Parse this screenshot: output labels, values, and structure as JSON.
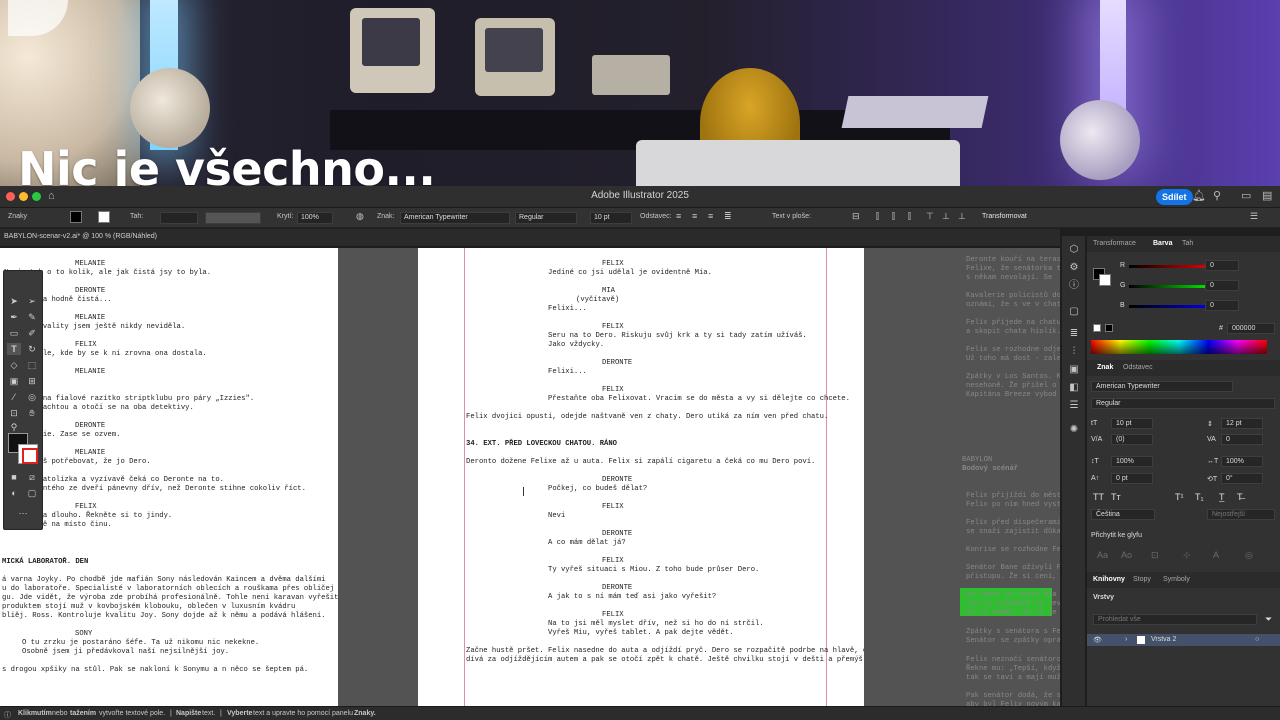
{
  "overlay": {
    "caption": "Nic je všechno..."
  },
  "titlebar": {
    "title": "Adobe Illustrator 2025",
    "share_label": "Sdílet"
  },
  "control_bar": {
    "panel_label": "Znaky",
    "stroke_label": "Tah:",
    "opacity_label": "Krytí:",
    "opacity_value": "100%",
    "character_label": "Znak:",
    "font_family": "American Typewriter",
    "font_style": "Regular",
    "font_size": "10 pt",
    "paragraph_label": "Odstavec:",
    "text_on_path_label": "Text v ploše:",
    "transform_label": "Transformovat"
  },
  "document_tab": {
    "label": "BABYLON-scenar-v2.ai* @ 100 % (RGB/Náhled)"
  },
  "script_left": {
    "lines": [
      "MELANIE",
      "Nevím tak o to kolik, ale jak čistá jsy to byla.",
      "DERONTE",
      "Je že byla hodně čistá...",
      "MELANIE",
      "kovýhle kvality jsem ještě nikdy neviděla.",
      "FELIX",
      "ně zajímale, kde by se k ní zrovna ona dostala.",
      "MELANIE",
      "že tady!",
      "ve ženy, na fialové razítko striptklubu pro páry „Izzies\".",
      "stvolu plachtou a otočí se na oba detektivy.",
      "DERONTE",
      "hoc Melanie. Zase se ozvem.",
      "MELANIE",
      "něco budeš potřebovat, že jo Dero.",
      "procesu patolízka a vyzívavě čeká co Deronte na to.",
      "ujce Derontého ze dveří pánevny dřív, než Deronte stihne cokoliv říct.",
      "FELIX",
      "ny bylo na dlouho. Řekněte si to jindy.",
      "sime ještě na místo činu.",
      "MICKÁ LABORATOŘ. DEN",
      "á varna Joyky. Po chodbě jde mafián Sony následován Kaincem a dvěma dalšími",
      "u do laboratoře. Specialisté v laboratorních oblecích a rouškama přes obličej",
      "gu. Jde vidět, že výroba zde probíhá profesionálně. Tohle není karavan vyřešit,",
      "produktem stojí muž v kovbojském klobouku, oblečen v luxusním kvádru",
      "bliěj. Ross. Kontroluje kvalitu Joy. Sony dojde až k němu a podává hlášení.",
      "SONY",
      "O tu zrzku je postaráno šéfe. Ta už nikomu nic nekekne.",
      "Osobně jsem ji předávkoval naší nejsilnější joy.",
      "s drogou xpšiky na stůl. Pak se nakloní k Sonymu a n něco se šeptem pá."
    ]
  },
  "script_mid": {
    "lines": [
      "FELIX",
      "Jediné co jsi udělal je ovidentně Mia.",
      "MIA",
      "(vyčítavě)",
      "Felixi...",
      "FELIX",
      "Seru na to Dero. Riskuju svůj krk a ty si tady zatím užíváš.",
      "Jako vždycky.",
      "DERONTE",
      "Felixi...",
      "FELIX",
      "Přestaňte oba Felixovat. Vracím se do města a vy si dělejte co chcete.",
      "Felix dvojici opustí, odejde naštvaně ven z chaty. Dero utíká za ním ven před chatu.",
      "34.      EXT. PŘED LOVECKOU CHATOU. RÁNO",
      "Deronto dožene Felixe až u auta. Felix si zapálí cigaretu a čeká co mu Dero poví.",
      "DERONTE",
      "Počkej, co budeš dělat?",
      "FELIX",
      "Nevi",
      "DERONTE",
      "A co mám dělat já?",
      "FELIX",
      "Ty vyřeš situaci s Miou. Z toho bude průser Dero.",
      "DERONTE",
      "A jak to s ní mám teď asi jako vyřešit?",
      "FELIX",
      "Na to jsi měl myslet dřív, než si ho do ní strčil.",
      "Vyřeš Miu, vyřeš tablet. A pak dejte vědět.",
      "Začne hustě pršet. Felix nasedne do auta a odjíždí pryč. Dero se rozpačitě podrbe na hlavě, chvíly se",
      "dívá za odjíždějícím autem a pak se otočí zpět k chatě. Ještě chvilku stojí v dešti a přemýšlí."
    ]
  },
  "script_right": {
    "lines": [
      "Deronte kouří na terase",
      "Felixe, že senátorka tam",
      "s někam nevolají. Se",
      "Kavaleríe policistů dore",
      "oznámí, že s ve v chatě",
      "Felix přijede na chatu p",
      "a skopit chata hiolík. Fel",
      "Felix se rozhodne odjet,",
      "Už toho má dost - zaleze",
      "Zpátky v Los Santos. K",
      "nesehoně. Že přišel o",
      "Kapitána Breeze vybod",
      "BABYLON",
      "Bodový scénář",
      "Felix přijíždí do města po",
      "Felix po nim hned vystat",
      "Felix před dispečerami",
      "se snaží zajistit důkazy, s",
      "Konrise se rozhodne Feli",
      "Senátor Bane oživyli Feli",
      "přistupu. Že si ceni, že c",
      "Na chatě se snaží Mia naj",
      "tím si vzpomene že nevyz",
      "že to vědět, že to je on. D",
      "Zpátky s senátora s Felix",
      "Senátor se zpátky oprávně",
      "Felix neznačí senátorovi",
      "Řekne mu: „Tepší, když",
      "tak se taví a mají muži s",
      "Pak senátor dodá, že si a",
      "aby byl Felix novým kapit"
    ]
  },
  "color_panel": {
    "tabs": [
      "Transformace",
      "Barva",
      "Tah"
    ],
    "active_tab": "Barva",
    "r_label": "R",
    "r_value": "0",
    "g_label": "G",
    "g_value": "0",
    "b_label": "B",
    "b_value": "0",
    "hex_label": "#",
    "hex_value": "000000"
  },
  "character_panel": {
    "tabs": [
      "Znak",
      "Odstavec"
    ],
    "active_tab": "Znak",
    "font_family": "American Typewriter",
    "font_style": "Regular",
    "font_size": "10 pt",
    "leading": "12 pt",
    "kerning": "(0)",
    "tracking": "0",
    "vscale": "100%",
    "hscale": "100%",
    "baseline": "0 pt",
    "rotation": "0°",
    "language": "Čeština",
    "hyphenation_placeholder": "Nejostřejší",
    "snap_label": "Přichytit ke glyfu"
  },
  "layers_panel": {
    "tabs": [
      "Knihovny",
      "Stopy",
      "Symboly"
    ],
    "active_tab": "Knihovny",
    "title": "Vrstvy",
    "search_placeholder": "Prohledat vše",
    "layer_name": "Vrstva 2"
  },
  "status": {
    "part1_bold": "Klikmutím",
    "part1": "nebo",
    "part2_bold": "tažením",
    "part2": "vytvořte textové pole.",
    "part3_bold": "Napište",
    "part3": "text.",
    "part4_bold": "Vyberte",
    "part4": "text a upravte ho pomocí panelu",
    "part5_bold": "Znaky."
  },
  "colors": {
    "accent": "#1473e6",
    "highlight": "#2fbe2f",
    "layer_selected": "#44516a",
    "margin_guide": "#e08fa0"
  }
}
